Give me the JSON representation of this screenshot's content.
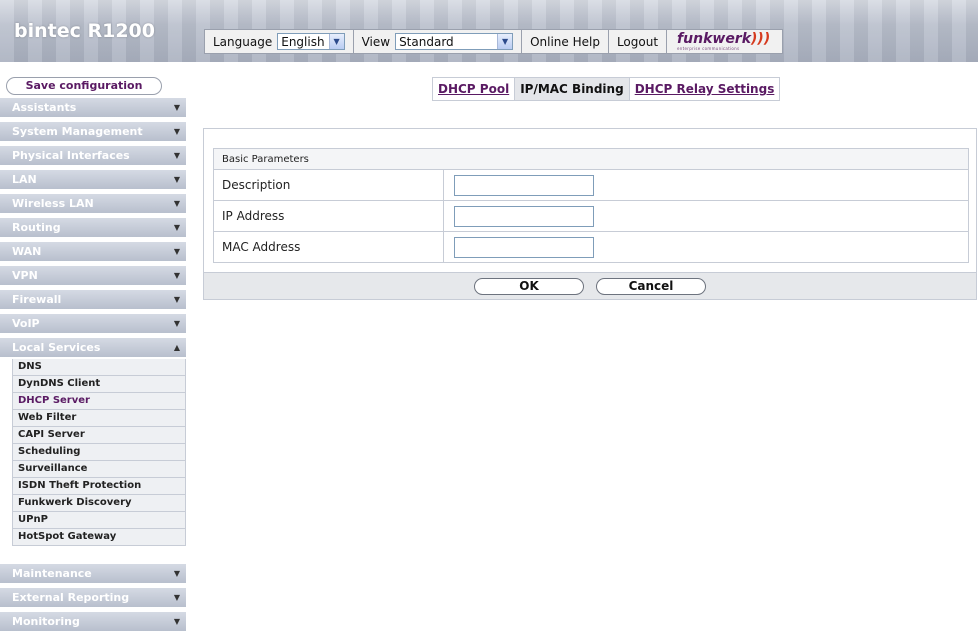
{
  "header": {
    "brand": "bintec R1200",
    "language_label": "Language",
    "language_value": "English",
    "view_label": "View",
    "view_value": "Standard",
    "online_help": "Online Help",
    "logout": "Logout",
    "logo_text": "funkwerk",
    "logo_tagline": "enterprise communications"
  },
  "sidebar": {
    "save_configuration": "Save configuration",
    "menu": [
      {
        "label": "Assistants",
        "state": "collapsed"
      },
      {
        "label": "System Management",
        "state": "collapsed"
      },
      {
        "label": "Physical Interfaces",
        "state": "collapsed"
      },
      {
        "label": "LAN",
        "state": "collapsed"
      },
      {
        "label": "Wireless LAN",
        "state": "collapsed"
      },
      {
        "label": "Routing",
        "state": "collapsed"
      },
      {
        "label": "WAN",
        "state": "collapsed"
      },
      {
        "label": "VPN",
        "state": "collapsed"
      },
      {
        "label": "Firewall",
        "state": "collapsed"
      },
      {
        "label": "VoIP",
        "state": "collapsed"
      },
      {
        "label": "Local Services",
        "state": "expanded"
      },
      {
        "label": "Maintenance",
        "state": "collapsed"
      },
      {
        "label": "External Reporting",
        "state": "collapsed"
      },
      {
        "label": "Monitoring",
        "state": "collapsed"
      }
    ],
    "local_services_items": [
      {
        "label": "DNS"
      },
      {
        "label": "DynDNS Client"
      },
      {
        "label": "DHCP Server",
        "active": true
      },
      {
        "label": "Web Filter"
      },
      {
        "label": "CAPI Server"
      },
      {
        "label": "Scheduling"
      },
      {
        "label": "Surveillance"
      },
      {
        "label": "ISDN Theft Protection"
      },
      {
        "label": "Funkwerk Discovery"
      },
      {
        "label": "UPnP"
      },
      {
        "label": "HotSpot Gateway"
      }
    ]
  },
  "tabs": [
    {
      "label": "DHCP Pool",
      "active": false
    },
    {
      "label": "IP/MAC Binding",
      "active": true
    },
    {
      "label": "DHCP Relay Settings",
      "active": false
    }
  ],
  "form": {
    "section_title": "Basic Parameters",
    "fields": [
      {
        "label": "Description",
        "value": ""
      },
      {
        "label": "IP Address",
        "value": ""
      },
      {
        "label": "MAC Address",
        "value": ""
      }
    ],
    "ok_label": "OK",
    "cancel_label": "Cancel"
  },
  "colors": {
    "accent_link": "#5a1a63",
    "menu_bar": "#b8bfcd",
    "header_bg": "#b9bfcc"
  }
}
